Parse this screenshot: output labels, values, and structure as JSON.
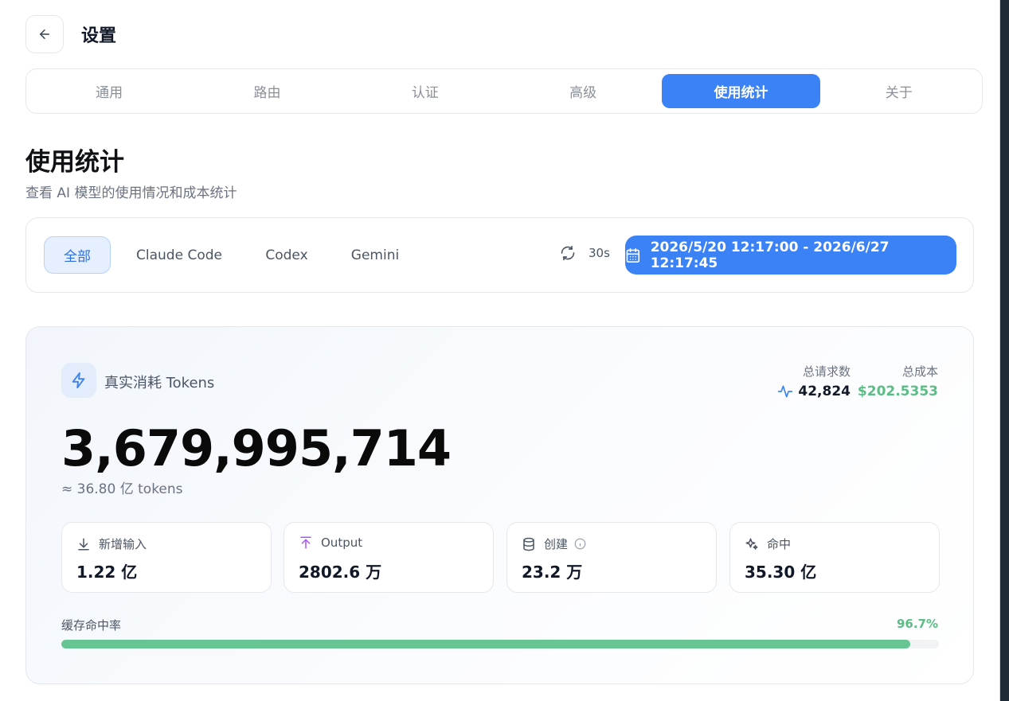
{
  "header": {
    "title": "设置",
    "back_icon": "arrow-left-icon"
  },
  "tabs": [
    {
      "label": "通用",
      "active": false
    },
    {
      "label": "路由",
      "active": false
    },
    {
      "label": "认证",
      "active": false
    },
    {
      "label": "高级",
      "active": false
    },
    {
      "label": "使用统计",
      "active": true
    },
    {
      "label": "关于",
      "active": false
    }
  ],
  "section": {
    "title": "使用统计",
    "subtitle": "查看 AI 模型的使用情况和成本统计"
  },
  "filters": {
    "sources": [
      "全部",
      "Claude Code",
      "Codex",
      "Gemini"
    ],
    "selected_source": "全部",
    "refresh_interval": "30s",
    "date_range": "2026/5/20 12:17:00 - 2026/6/27 12:17:45"
  },
  "summary": {
    "label": "真实消耗 Tokens",
    "total_tokens": "3,679,995,714",
    "approx": "≈ 36.80 亿 tokens",
    "requests_label": "总请求数",
    "requests_value": "42,824",
    "cost_label": "总成本",
    "cost_value": "$202.5353",
    "metrics": [
      {
        "label": "新增输入",
        "value": "1.22 亿",
        "icon": "download-icon"
      },
      {
        "label": "Output",
        "value": "2802.6 万",
        "icon": "upload-icon"
      },
      {
        "label": "创建",
        "value": "23.2 万",
        "icon": "database-icon"
      },
      {
        "label": "命中",
        "value": "35.30 亿",
        "icon": "sparkles-icon"
      }
    ],
    "cache_hit_label": "缓存命中率",
    "cache_hit_value": "96.7%",
    "cache_hit_fraction": 0.967
  },
  "colors": {
    "accent": "#3b82f6",
    "cost_green": "#5bbd85",
    "progress_fill": "#66c592",
    "output_purple": "#a855f7"
  }
}
